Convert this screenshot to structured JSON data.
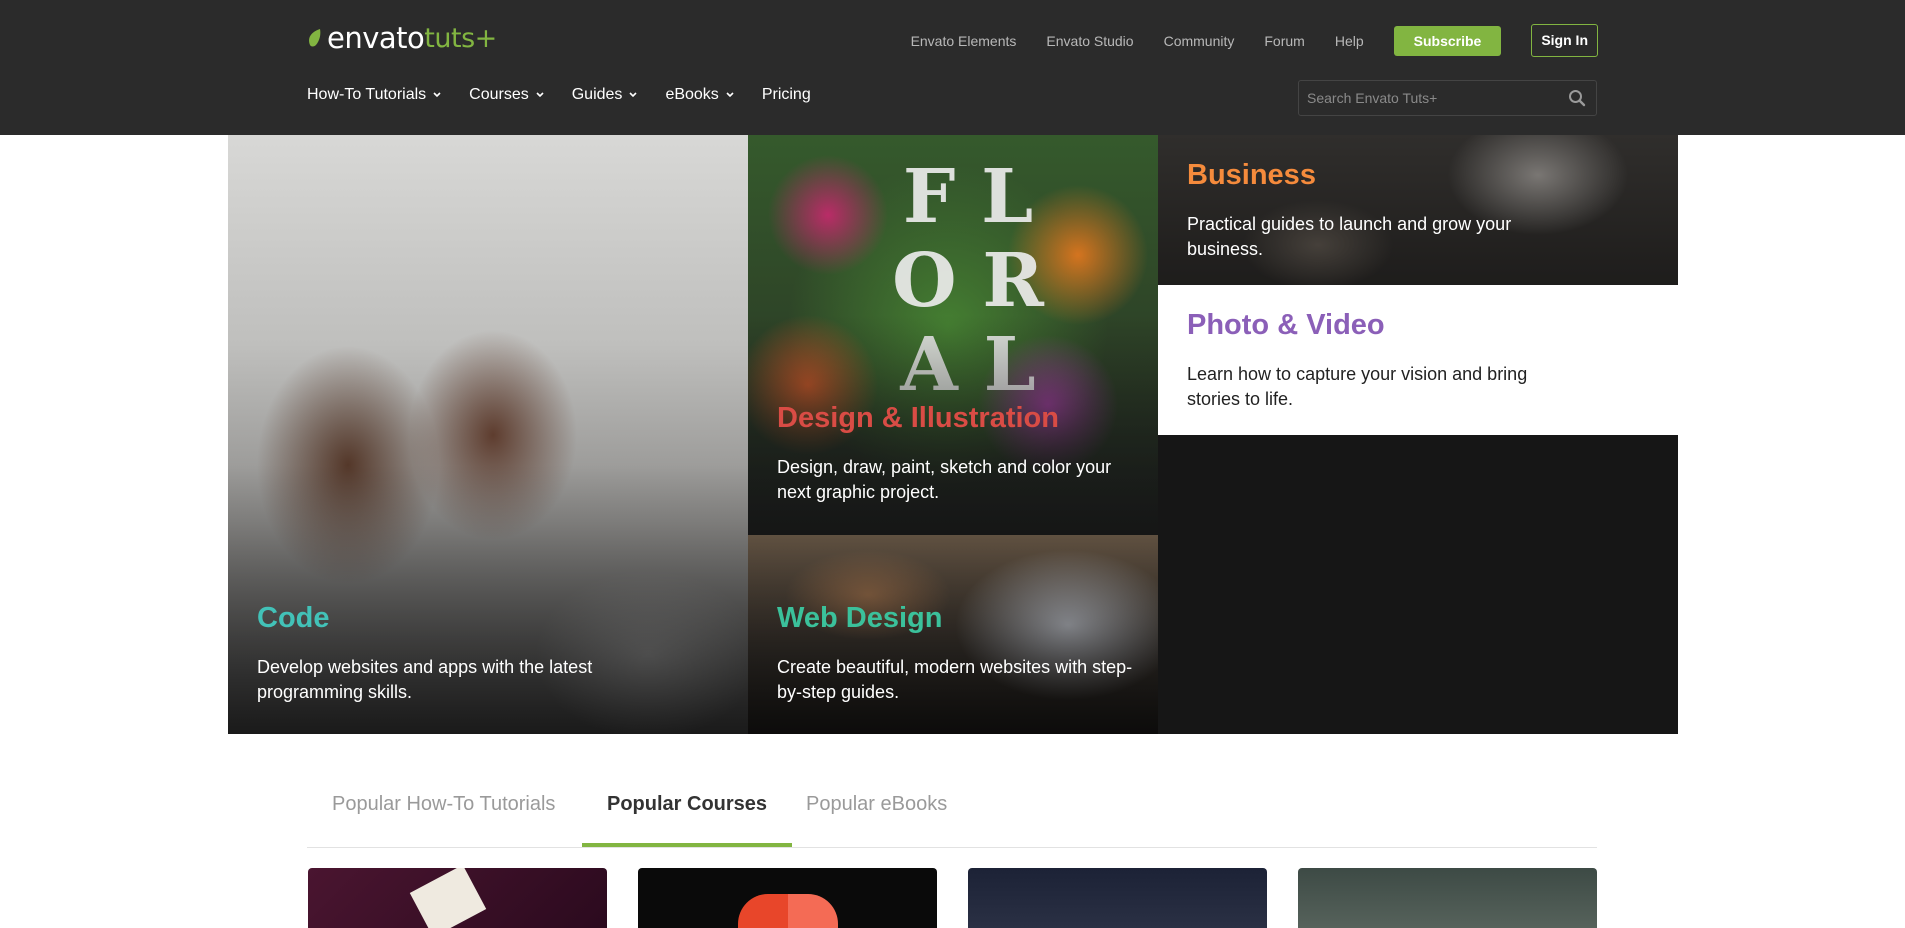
{
  "logo": {
    "brand": "envato",
    "product": "tuts+"
  },
  "top_links": [
    "Envato Elements",
    "Envato Studio",
    "Community",
    "Forum",
    "Help"
  ],
  "subscribe_label": "Subscribe",
  "signin_label": "Sign In",
  "main_nav": [
    {
      "label": "How-To Tutorials",
      "dropdown": true
    },
    {
      "label": "Courses",
      "dropdown": true
    },
    {
      "label": "Guides",
      "dropdown": true
    },
    {
      "label": "eBooks",
      "dropdown": true
    },
    {
      "label": "Pricing",
      "dropdown": false
    }
  ],
  "search": {
    "placeholder": "Search Envato Tuts+",
    "value": ""
  },
  "hero": {
    "code": {
      "title": "Code",
      "desc": "Develop websites and apps with the latest programming skills."
    },
    "design": {
      "title": "Design & Illustration",
      "desc": "Design, draw, paint, sketch and color your next graphic project.",
      "art_letters": [
        "F L",
        "O R",
        "A L"
      ]
    },
    "web": {
      "title": "Web Design",
      "desc": "Create beautiful, modern websites with step-by-step guides."
    },
    "business": {
      "title": "Business",
      "desc": "Practical guides to launch and grow your business."
    },
    "photo": {
      "title": "Photo & Video",
      "desc": "Learn how to capture your vision and bring stories to life."
    }
  },
  "tabs": [
    {
      "label": "Popular How-To Tutorials",
      "active": false
    },
    {
      "label": "Popular Courses",
      "active": true
    },
    {
      "label": "Popular eBooks",
      "active": false
    }
  ],
  "colors": {
    "accent": "#82b541",
    "header_bg": "#2b2b2b",
    "code": "#42c2b8",
    "design": "#d94c45",
    "web": "#3bc19b",
    "business": "#f58b3c",
    "photo": "#8b5fb8"
  }
}
